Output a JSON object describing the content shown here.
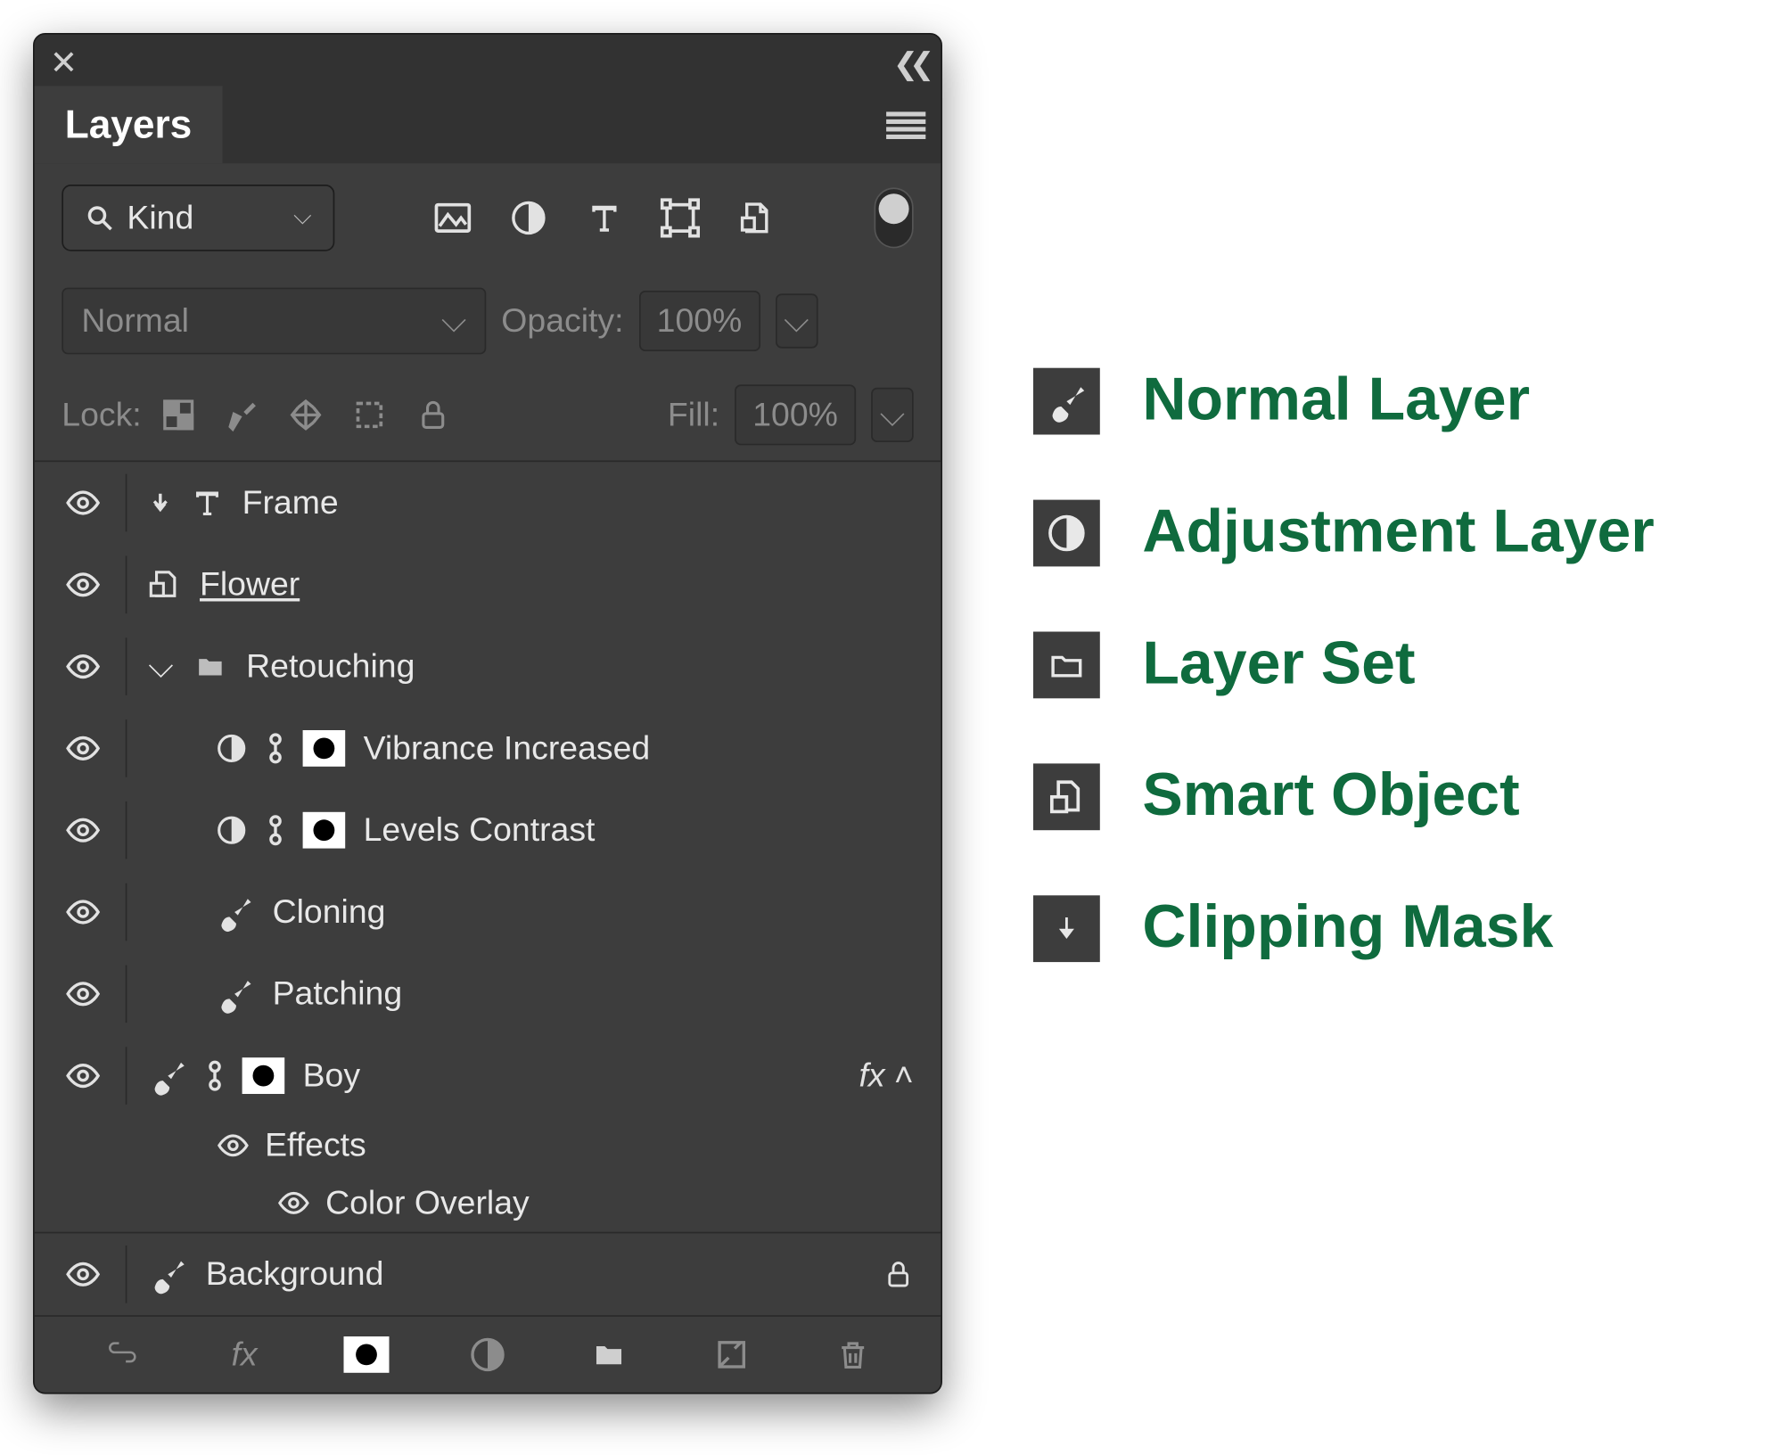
{
  "panel": {
    "title": "Layers",
    "filter": {
      "kind_label": "Kind"
    },
    "blend": {
      "mode": "Normal",
      "opacity_label": "Opacity:",
      "opacity_value": "100%"
    },
    "lock": {
      "label": "Lock:",
      "fill_label": "Fill:",
      "fill_value": "100%"
    },
    "layers": {
      "frame": "Frame",
      "flower": "Flower",
      "retouching": "Retouching",
      "vibrance": "Vibrance Increased",
      "levels": "Levels Contrast",
      "cloning": "Cloning",
      "patching": "Patching",
      "boy": "Boy",
      "fx": "fx",
      "effects": "Effects",
      "color_overlay": "Color Overlay",
      "background": "Background"
    }
  },
  "legend": {
    "normal": "Normal Layer",
    "adjustment": "Adjustment Layer",
    "set": "Layer Set",
    "smart": "Smart Object",
    "clip": "Clipping Mask"
  }
}
